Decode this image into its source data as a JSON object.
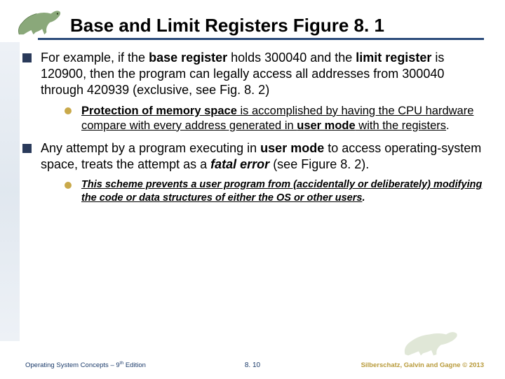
{
  "title": "Base and Limit Registers Figure 8. 1",
  "bullets": {
    "b1": {
      "pre": "For example, if the ",
      "bold1": "base register",
      "mid1": " holds 300040 and the ",
      "bold2": "limit register",
      "post": " is 120900, then the program can legally access all addresses from 300040 through 420939 (exclusive, see Fig. 8. 2)"
    },
    "b1sub": {
      "u1": "Protection of memory space",
      "mid": " is accomplished by having the CPU hardware compare  with every address generated in ",
      "u2": "user mode",
      "u3": " with the registers",
      "dot": "."
    },
    "b2": {
      "pre": "Any attempt by a program executing in ",
      "bold1": "user mode",
      "mid1": " to access operating-system space,  treats the attempt as a ",
      "ital": "fatal error",
      "post": " (see Figure 8. 2)."
    },
    "b2sub": {
      "text": "This scheme prevents a user program from (accidentally or deliberately) modifying the code or data structures of either the OS or other users",
      "dot": "."
    }
  },
  "footer": {
    "left_a": "Operating System Concepts – 9",
    "left_b": " Edition",
    "center": "8. 10",
    "right": "Silberschatz, Galvin and Gagne © 2013"
  }
}
